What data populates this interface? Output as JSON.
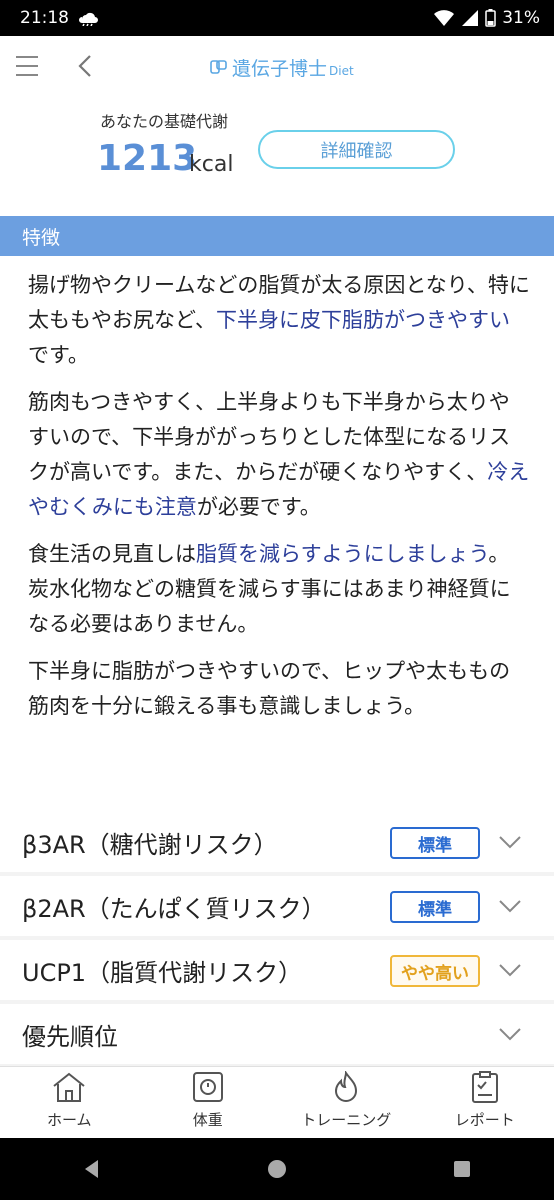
{
  "status": {
    "time": "21:18",
    "battery": "31%"
  },
  "header": {
    "brand": "遺伝子博士",
    "brand_sub": "Diet"
  },
  "bmr": {
    "label": "あなたの基礎代謝",
    "value": "1213",
    "unit": "kcal",
    "detail_button": "詳細確認"
  },
  "section": {
    "title": "特徴"
  },
  "paragraphs": [
    [
      {
        "t": "揚げ物やクリームなどの脂質が太る原因となり、特に太ももやお尻など、"
      },
      {
        "t": "下半身に皮下脂肪がつきやすい",
        "hl": true
      },
      {
        "t": "です。"
      }
    ],
    [
      {
        "t": "筋肉もつきやすく、上半身よりも下半身から太りやすいので、下半身ががっちりとした体型になるリスクが高いです。また、からだが硬くなりやすく、"
      },
      {
        "t": "冷えやむくみにも注意",
        "hl": true
      },
      {
        "t": "が必要です。"
      }
    ],
    [
      {
        "t": "食生活の見直しは"
      },
      {
        "t": "脂質を減らすようにしましょう",
        "hl": true
      },
      {
        "t": "。炭水化物などの糖質を減らす事にはあまり神経質になる必要はありません。"
      }
    ],
    [
      {
        "t": "下半身に脂肪がつきやすいので、ヒップや太ももの筋肉を十分に鍛える事も意識しましょう。"
      }
    ]
  ],
  "accordion": [
    {
      "label": "β3AR（糖代謝リスク）",
      "badge": "標準",
      "level": "std"
    },
    {
      "label": "β2AR（たんぱく質リスク）",
      "badge": "標準",
      "level": "std"
    },
    {
      "label": "UCP1（脂質代謝リスク）",
      "badge": "やや高い",
      "level": "high"
    },
    {
      "label": "優先順位",
      "badge": "",
      "level": ""
    }
  ],
  "bottom_nav": [
    {
      "label": "ホーム",
      "icon": "home-icon"
    },
    {
      "label": "体重",
      "icon": "scale-icon"
    },
    {
      "label": "トレーニング",
      "icon": "flame-icon"
    },
    {
      "label": "レポート",
      "icon": "report-icon"
    }
  ],
  "colors": {
    "accent": "#6c9fe0",
    "highlight": "#2d3f9a",
    "brand": "#5aa7e3",
    "badge_std": "#2a6bd1",
    "badge_high": "#f0b73a"
  }
}
